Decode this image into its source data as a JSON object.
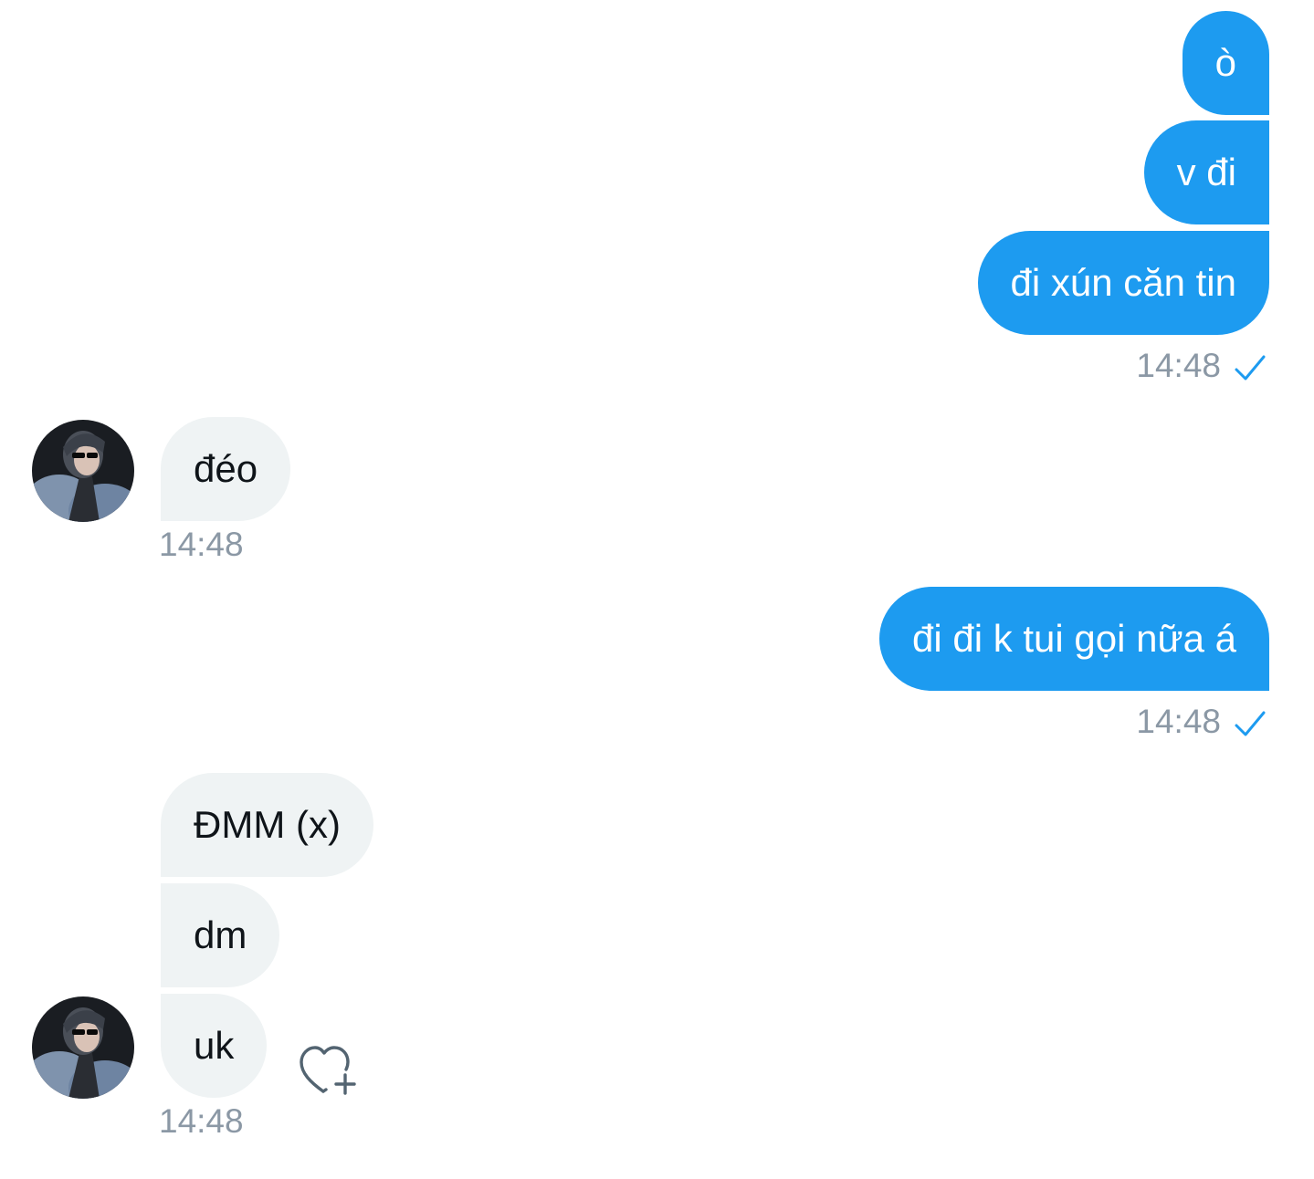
{
  "conversation": {
    "sent_group_1": {
      "messages": [
        "ò",
        "v đi",
        "đi xún căn tin"
      ],
      "time": "14:48",
      "status_icon": "check-icon"
    },
    "received_group_1": {
      "messages": [
        "đéo"
      ],
      "time": "14:48",
      "avatar": "avatar"
    },
    "sent_group_2": {
      "messages": [
        "đi đi k tui gọi nữa á"
      ],
      "time": "14:48",
      "status_icon": "check-icon"
    },
    "received_group_2": {
      "messages": [
        "ĐMM (x)",
        "dm",
        "uk"
      ],
      "time": "14:48",
      "avatar": "avatar",
      "reaction_icon": "heart-plus-icon"
    }
  },
  "colors": {
    "sent_bubble": "#1d9bf0",
    "received_bubble": "#eff3f4",
    "timestamp": "#8b98a5",
    "check": "#1d9bf0"
  }
}
